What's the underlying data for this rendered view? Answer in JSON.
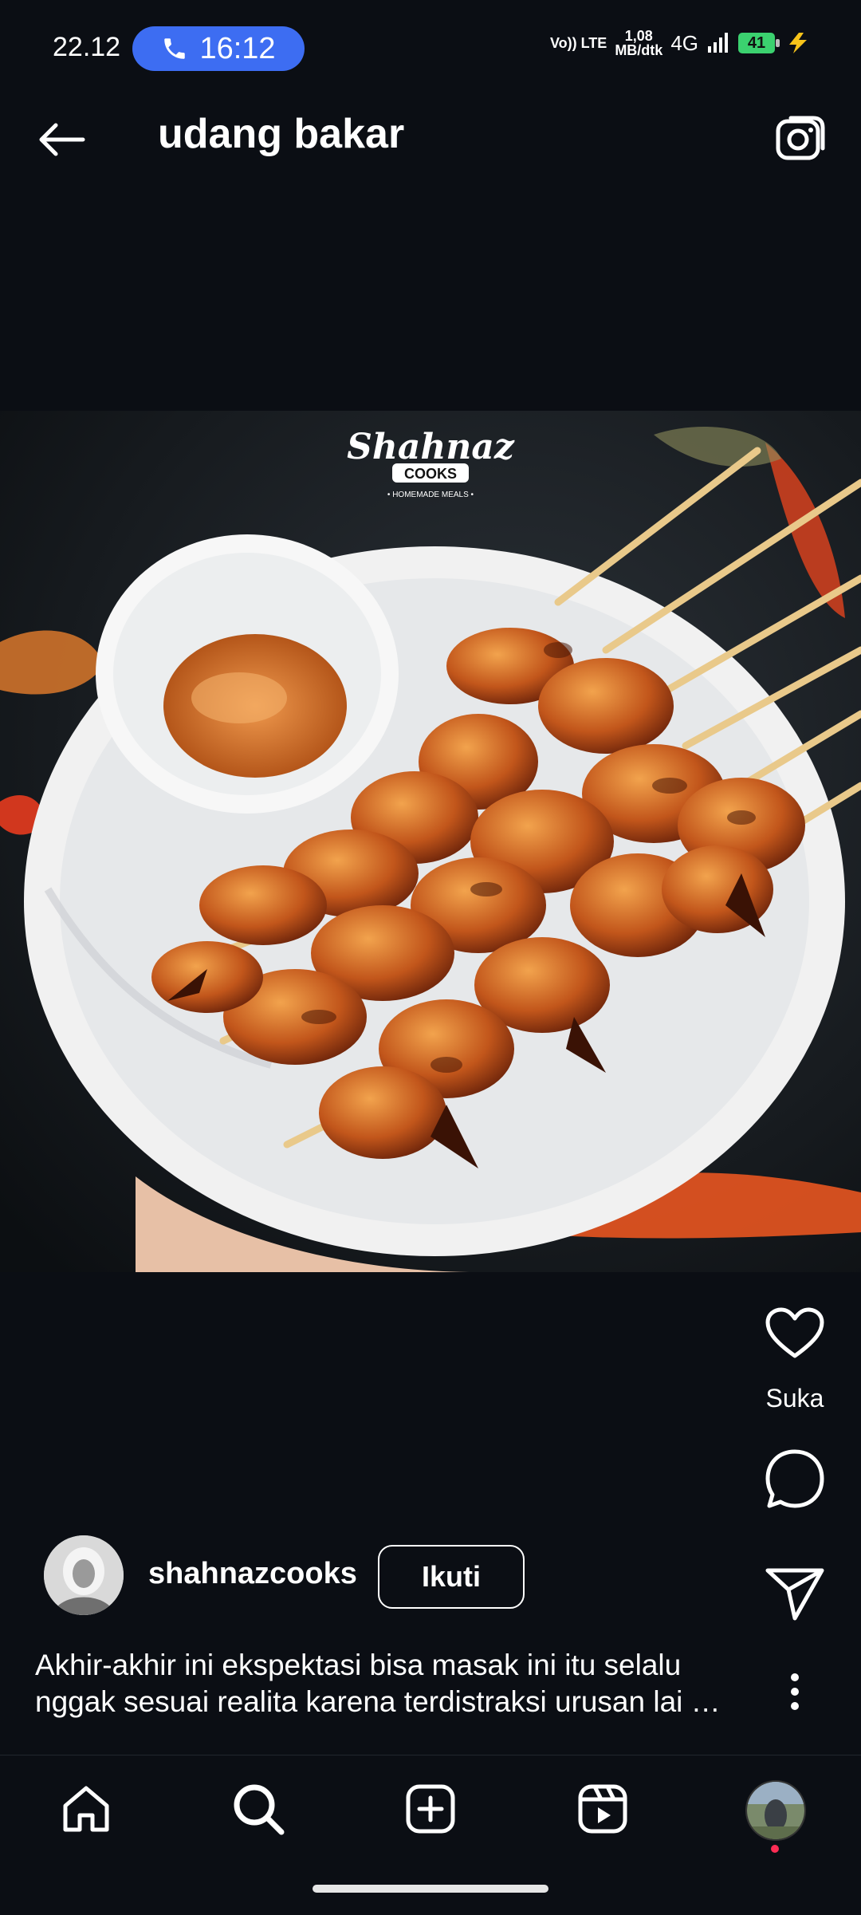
{
  "status_bar": {
    "time": "22.12",
    "call_duration": "16:12",
    "volte": "Vo)) LTE",
    "speed_value": "1,08",
    "speed_unit": "MB/dtk",
    "network": "4G",
    "battery": "41"
  },
  "header": {
    "title": "udang bakar",
    "back_icon": "back-arrow-icon",
    "camera_icon": "camera-icon"
  },
  "post": {
    "photo_watermark": "Shahnaz COOKS HOMEMADE MEALS",
    "like_label": "Suka",
    "username": "shahnazcooks",
    "follow_label": "Ikuti",
    "caption": "Akhir-akhir ini ekspektasi bisa masak ini itu selalu nggak sesuai realita karena terdistraksi urusan lai …"
  },
  "bottom_nav": [
    {
      "name": "home",
      "icon": "home-icon"
    },
    {
      "name": "search",
      "icon": "search-icon"
    },
    {
      "name": "create",
      "icon": "plus-square-icon"
    },
    {
      "name": "reels",
      "icon": "reels-icon"
    },
    {
      "name": "profile",
      "icon": "profile-avatar"
    }
  ],
  "colors": {
    "background": "#0b0e14",
    "call_pill": "#3d6df2",
    "battery": "#3bd16f",
    "notification_dot": "#ff2d55"
  }
}
